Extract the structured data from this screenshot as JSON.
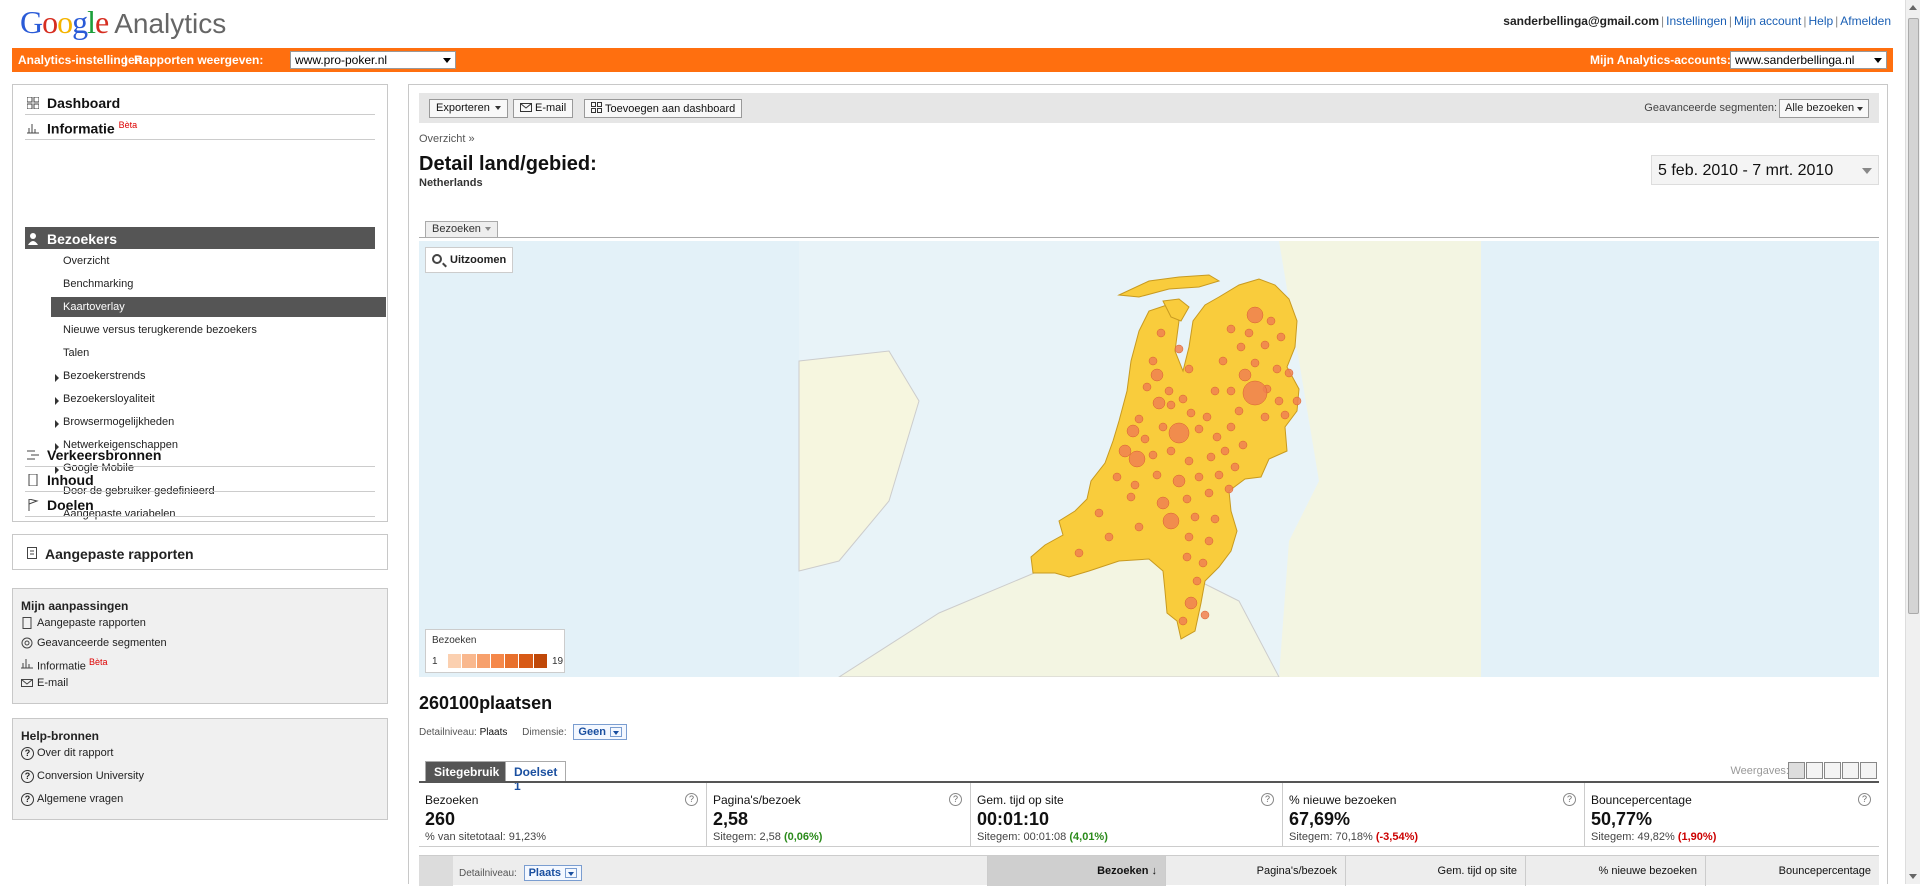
{
  "header": {
    "logo_word": "Google",
    "product": "Analytics",
    "email": "sanderbellinga@gmail.com",
    "links": [
      "Instellingen",
      "Mijn account",
      "Help",
      "Afmelden"
    ]
  },
  "orangebar": {
    "settings_label": "Analytics-instellingen",
    "reports_label": "Rapporten weergeven:",
    "reports_value": "www.pro-poker.nl",
    "accounts_label": "Mijn Analytics-accounts:",
    "accounts_value": "www.sanderbellinga.nl"
  },
  "nav": {
    "dashboard": "Dashboard",
    "informatie": "Informatie",
    "beta": "Bèta",
    "bezoekers": "Bezoekers",
    "subitems": [
      {
        "label": "Overzicht"
      },
      {
        "label": "Benchmarking"
      },
      {
        "label": "Kaartoverlay"
      },
      {
        "label": "Nieuwe versus terugkerende bezoekers"
      },
      {
        "label": "Talen"
      },
      {
        "label": "Bezoekerstrends"
      },
      {
        "label": "Bezoekersloyaliteit"
      },
      {
        "label": "Browsermogelijkheden"
      },
      {
        "label": "Netwerkeigenschappen"
      },
      {
        "label": "Google Mobile"
      },
      {
        "label": "Door de gebruiker gedefinieerd"
      },
      {
        "label": "Aangepaste variabelen"
      }
    ],
    "verkeersbronnen": "Verkeersbronnen",
    "inhoud": "Inhoud",
    "doelen": "Doelen"
  },
  "custom_reports": "Aangepaste rapporten",
  "aanpassingen": {
    "title": "Mijn aanpassingen",
    "items": [
      "Aangepaste rapporten",
      "Geavanceerde segmenten",
      "Informatie",
      "E-mail"
    ],
    "beta": "Bèta"
  },
  "help": {
    "title": "Help-bronnen",
    "items": [
      "Over dit rapport",
      "Conversion University",
      "Algemene vragen"
    ]
  },
  "toolbar": {
    "export": "Exporteren",
    "email": "E-mail",
    "add_dashboard": "Toevoegen aan dashboard",
    "segments_label": "Geavanceerde segmenten:",
    "segments_value": "Alle bezoeken"
  },
  "breadcrumb": "Overzicht »",
  "title": "Detail land/gebied:",
  "subtitle": "Netherlands",
  "daterange": "5 feb. 2010 - 7 mrt. 2010",
  "map": {
    "tab": "Bezoeken",
    "zoomout": "Uitzoomen",
    "legend_title": "Bezoeken",
    "legend_min": "1",
    "legend_max": "19",
    "land_color": "#f9cc3c",
    "dot_color": "#f08050"
  },
  "places": {
    "title": "260100plaatsen",
    "detail_label": "Detailniveau:",
    "detail_value": "Plaats",
    "dimension_label": "Dimensie:",
    "dimension_value": "Geen"
  },
  "tabs": {
    "site_usage": "Sitegebruik",
    "goalset": "Doelset 1",
    "views_label": "Weergaves:"
  },
  "metrics": [
    {
      "title": "Bezoeken",
      "value": "260",
      "sub": "% van sitetotaal: 91,23%",
      "delta": "",
      "delta_type": ""
    },
    {
      "title": "Pagina's/bezoek",
      "value": "2,58",
      "sub": "Sitegem: 2,58",
      "delta": "(0,06%)",
      "delta_type": "pos"
    },
    {
      "title": "Gem. tijd op site",
      "value": "00:01:10",
      "sub": "Sitegem: 00:01:08",
      "delta": "(4,01%)",
      "delta_type": "pos"
    },
    {
      "title": "% nieuwe bezoeken",
      "value": "67,69%",
      "sub": "Sitegem: 70,18%",
      "delta": "(-3,54%)",
      "delta_type": "neg"
    },
    {
      "title": "Bouncepercentage",
      "value": "50,77%",
      "sub": "Sitegem: 49,82%",
      "delta": "(1,90%)",
      "delta_type": "neg"
    }
  ],
  "table": {
    "detail_label": "Detailniveau:",
    "detail_value": "Plaats",
    "columns": [
      "Bezoeken",
      "Pagina's/bezoek",
      "Gem. tijd op site",
      "% nieuwe bezoeken",
      "Bouncepercentage"
    ]
  }
}
